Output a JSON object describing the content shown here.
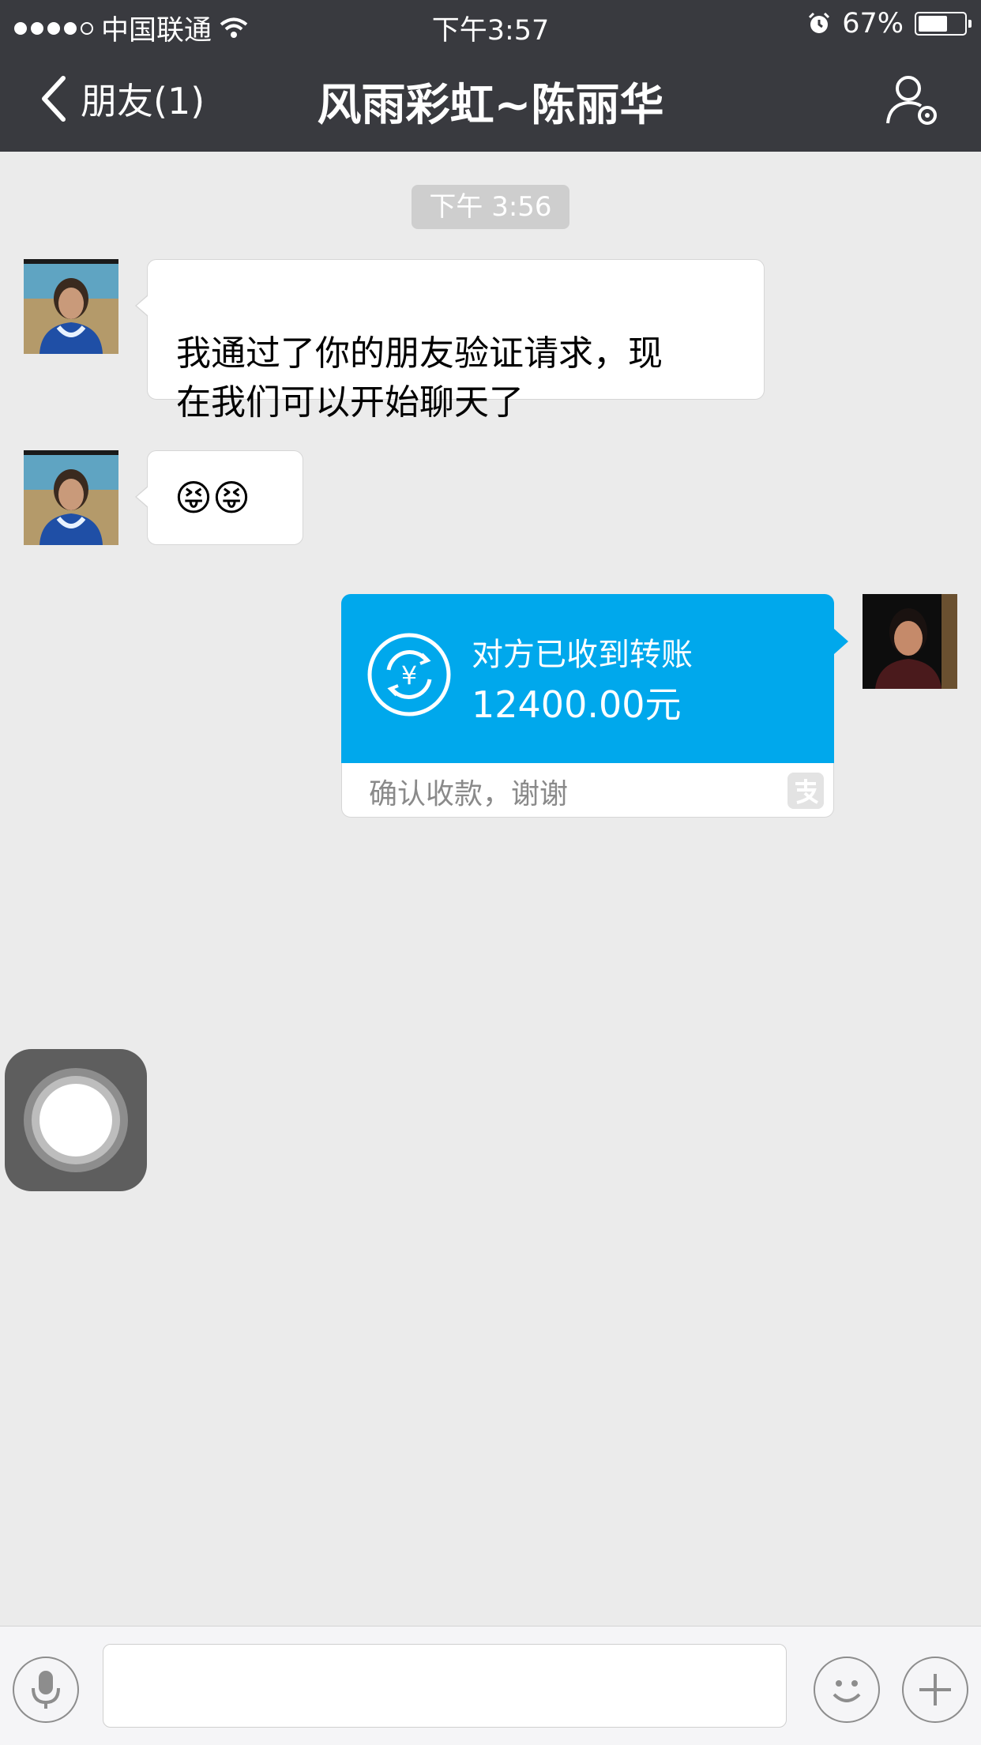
{
  "status_bar": {
    "carrier": "中国联通",
    "time": "下午3:57",
    "battery": "67%",
    "battery_level": 0.67,
    "signal_bars_filled": 4,
    "signal_bars_total": 5
  },
  "nav": {
    "back_label": "朋友(1)",
    "title": "风雨彩虹~陈丽华"
  },
  "chat": {
    "timestamp": "下午 3:56",
    "messages": [
      {
        "from": "contact",
        "text": "我通过了你的朋友验证请求，现\n在我们可以开始聊天了"
      },
      {
        "from": "contact",
        "text": "😝😝"
      }
    ],
    "transfer": {
      "from": "me",
      "title": "对方已收到转账",
      "amount": "12400.00元",
      "note": "确认收款，谢谢",
      "accent_color": "#00a8ec"
    }
  },
  "input_bar": {
    "voice_icon": "microphone-icon",
    "emoji_icon": "smiley-icon",
    "more_icon": "plus-icon",
    "placeholder": ""
  },
  "colors": {
    "header_bg": "#393a3f",
    "chat_bg": "#ebebeb"
  }
}
